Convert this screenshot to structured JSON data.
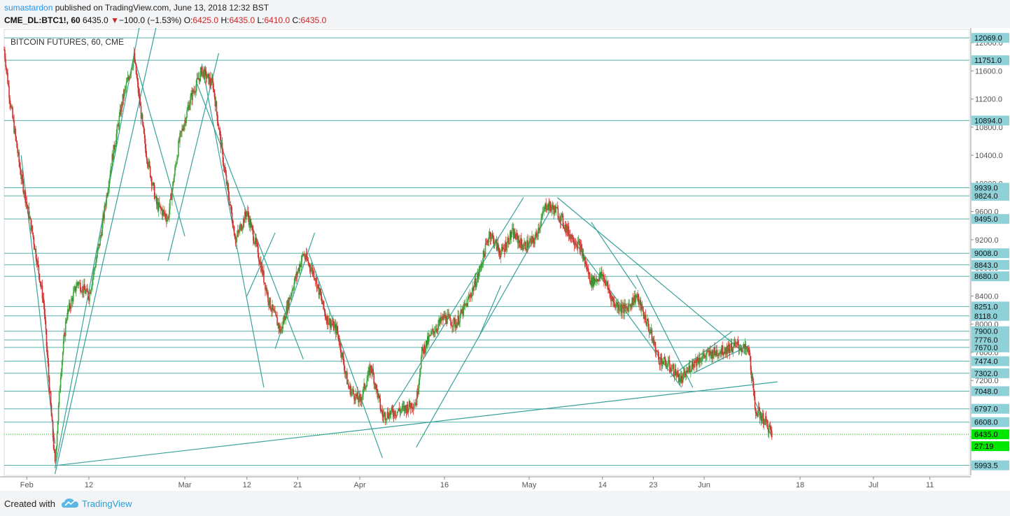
{
  "header": {
    "author": "sumastardon",
    "published": " published on TradingView.com, June 13, 2018 12:32 BST",
    "symbol": "CME_DL:BTC1!, 60",
    "last": "6435.0",
    "arrow": "▼",
    "change": "−100.0 (−1.53%)",
    "o_label": "O:",
    "o_value": "6425.0",
    "h_label": "H:",
    "h_value": "6435.0",
    "l_label": "L:",
    "l_value": "6410.0",
    "c_label": "C:",
    "c_value": "6435.0"
  },
  "footer": {
    "created_with": "Created with",
    "brand": "TradingView",
    "logo_icon": "tradingview-cloud-icon"
  },
  "colors": {
    "up": "#26a69a",
    "candle_up": "#3fa63f",
    "candle_down": "#d0332f",
    "trendline": "#3aa29a",
    "level_label_bg": "#8fd1d8",
    "last_price_bg": "#00e600",
    "current_line": "#00cc00"
  },
  "chart_data": {
    "type": "candlestick",
    "title": "BITCOIN FUTURES, 60, CME",
    "y_range": [
      5850,
      12150
    ],
    "y_ticks": [
      "12000.0",
      "11600.0",
      "11200.0",
      "10800.0",
      "10400.0",
      "10000.0",
      "9600.0",
      "9200.0",
      "8800.0",
      "8400.0",
      "8000.0",
      "7600.0",
      "7200.0",
      "6800.0",
      "6400.0",
      "6000.0"
    ],
    "x_range_days": [
      "2018-01-28",
      "2018-07-18"
    ],
    "x_ticks": [
      {
        "label": "Feb",
        "date": "2018-02-01"
      },
      {
        "label": "12",
        "date": "2018-02-12"
      },
      {
        "label": "Mar",
        "date": "2018-03-01"
      },
      {
        "label": "12",
        "date": "2018-03-12"
      },
      {
        "label": "21",
        "date": "2018-03-21"
      },
      {
        "label": "Apr",
        "date": "2018-04-01"
      },
      {
        "label": "16",
        "date": "2018-04-16"
      },
      {
        "label": "May",
        "date": "2018-05-01"
      },
      {
        "label": "14",
        "date": "2018-05-14"
      },
      {
        "label": "23",
        "date": "2018-05-23"
      },
      {
        "label": "Jun",
        "date": "2018-06-01"
      },
      {
        "label": "18",
        "date": "2018-06-18"
      },
      {
        "label": "Jul",
        "date": "2018-07-01"
      },
      {
        "label": "11",
        "date": "2018-07-11"
      }
    ],
    "levels": [
      "12069.0",
      "11751.0",
      "10894.0",
      "9939.0",
      "9824.0",
      "9495.0",
      "9008.0",
      "8843.0",
      "8680.0",
      "8251.0",
      "8118.0",
      "7900.0",
      "7776.0",
      "7670.0",
      "7474.0",
      "7302.0",
      "7048.0",
      "6797.0",
      "6608.0",
      "5993.5"
    ],
    "last_price": "6435.0",
    "countdown": "27:19",
    "price_path": [
      [
        "2018-01-28",
        11900
      ],
      [
        "2018-01-29",
        11200
      ],
      [
        "2018-01-31",
        10100
      ],
      [
        "2018-02-02",
        9300
      ],
      [
        "2018-02-04",
        8300
      ],
      [
        "2018-02-05",
        7100
      ],
      [
        "2018-02-06",
        6000
      ],
      [
        "2018-02-07",
        7300
      ],
      [
        "2018-02-08",
        8100
      ],
      [
        "2018-02-10",
        8600
      ],
      [
        "2018-02-12",
        8400
      ],
      [
        "2018-02-14",
        9200
      ],
      [
        "2018-02-16",
        10300
      ],
      [
        "2018-02-18",
        11200
      ],
      [
        "2018-02-20",
        11800
      ],
      [
        "2018-02-22",
        10500
      ],
      [
        "2018-02-24",
        9700
      ],
      [
        "2018-02-26",
        9500
      ],
      [
        "2018-02-28",
        10600
      ],
      [
        "2018-03-02",
        11200
      ],
      [
        "2018-03-04",
        11600
      ],
      [
        "2018-03-06",
        11400
      ],
      [
        "2018-03-08",
        10200
      ],
      [
        "2018-03-10",
        9200
      ],
      [
        "2018-03-12",
        9600
      ],
      [
        "2018-03-14",
        9000
      ],
      [
        "2018-03-16",
        8300
      ],
      [
        "2018-03-18",
        7900
      ],
      [
        "2018-03-20",
        8500
      ],
      [
        "2018-03-22",
        9000
      ],
      [
        "2018-03-24",
        8700
      ],
      [
        "2018-03-26",
        8100
      ],
      [
        "2018-03-28",
        7900
      ],
      [
        "2018-03-30",
        7100
      ],
      [
        "2018-04-01",
        6900
      ],
      [
        "2018-04-03",
        7400
      ],
      [
        "2018-04-05",
        6700
      ],
      [
        "2018-04-07",
        6750
      ],
      [
        "2018-04-09",
        6800
      ],
      [
        "2018-04-11",
        6900
      ],
      [
        "2018-04-12",
        7600
      ],
      [
        "2018-04-14",
        7900
      ],
      [
        "2018-04-16",
        8100
      ],
      [
        "2018-04-18",
        8000
      ],
      [
        "2018-04-20",
        8300
      ],
      [
        "2018-04-22",
        8700
      ],
      [
        "2018-04-24",
        9300
      ],
      [
        "2018-04-26",
        9000
      ],
      [
        "2018-04-28",
        9300
      ],
      [
        "2018-04-30",
        9100
      ],
      [
        "2018-05-02",
        9200
      ],
      [
        "2018-05-04",
        9700
      ],
      [
        "2018-05-06",
        9600
      ],
      [
        "2018-05-08",
        9300
      ],
      [
        "2018-05-10",
        9100
      ],
      [
        "2018-05-12",
        8600
      ],
      [
        "2018-05-14",
        8700
      ],
      [
        "2018-05-16",
        8300
      ],
      [
        "2018-05-18",
        8200
      ],
      [
        "2018-05-20",
        8400
      ],
      [
        "2018-05-22",
        8000
      ],
      [
        "2018-05-24",
        7500
      ],
      [
        "2018-05-26",
        7400
      ],
      [
        "2018-05-28",
        7200
      ],
      [
        "2018-05-30",
        7450
      ],
      [
        "2018-06-01",
        7550
      ],
      [
        "2018-06-03",
        7600
      ],
      [
        "2018-06-05",
        7650
      ],
      [
        "2018-06-07",
        7700
      ],
      [
        "2018-06-09",
        7600
      ],
      [
        "2018-06-10",
        6800
      ],
      [
        "2018-06-12",
        6600
      ],
      [
        "2018-06-13",
        6435
      ]
    ]
  }
}
